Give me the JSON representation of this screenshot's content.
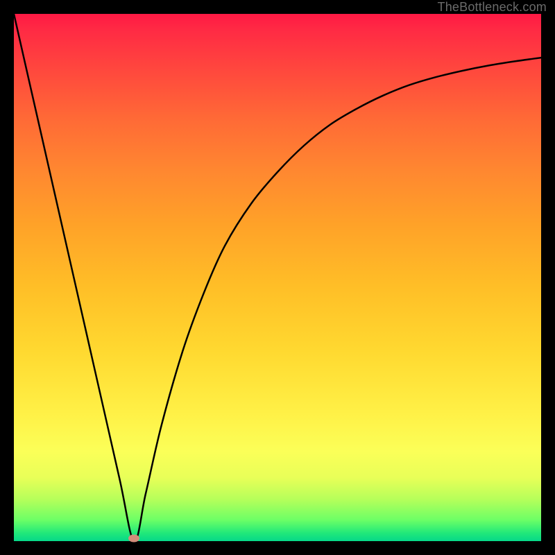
{
  "watermark": "TheBottleneck.com",
  "marker": {
    "x_pct": 22.8,
    "y_pct": 99.5
  },
  "colors": {
    "frame": "#000000",
    "curve": "#000000",
    "marker": "#d38c7a",
    "watermark": "#6b6b6b",
    "gradient_top": "#ff1944",
    "gradient_mid": "#ffd930",
    "gradient_bottom": "#06d889"
  },
  "chart_data": {
    "type": "line",
    "title": "",
    "xlabel": "",
    "ylabel": "",
    "xlim": [
      0,
      100
    ],
    "ylim": [
      0,
      100
    ],
    "grid": false,
    "legend": false,
    "series": [
      {
        "name": "bottleneck-curve",
        "x": [
          0,
          5,
          10,
          15,
          20,
          22.8,
          25,
          28,
          32,
          36,
          40,
          45,
          50,
          55,
          60,
          65,
          70,
          75,
          80,
          85,
          90,
          95,
          100
        ],
        "values": [
          100,
          78,
          56,
          34,
          12,
          0,
          9,
          22,
          36,
          47,
          56,
          64,
          70,
          75,
          79,
          82,
          84.5,
          86.5,
          88,
          89.2,
          90.2,
          91,
          91.7
        ]
      }
    ],
    "markers": [
      {
        "name": "optimal-point",
        "x": 22.8,
        "y": 0.5
      }
    ],
    "background_gradient": {
      "orientation": "vertical",
      "stops": [
        {
          "pct": 0,
          "color": "#ff1944"
        },
        {
          "pct": 10,
          "color": "#ff453e"
        },
        {
          "pct": 30,
          "color": "#ff8830"
        },
        {
          "pct": 52,
          "color": "#ffbf27"
        },
        {
          "pct": 76,
          "color": "#fff147"
        },
        {
          "pct": 92,
          "color": "#b7ff5a"
        },
        {
          "pct": 100,
          "color": "#06d889"
        }
      ]
    }
  }
}
